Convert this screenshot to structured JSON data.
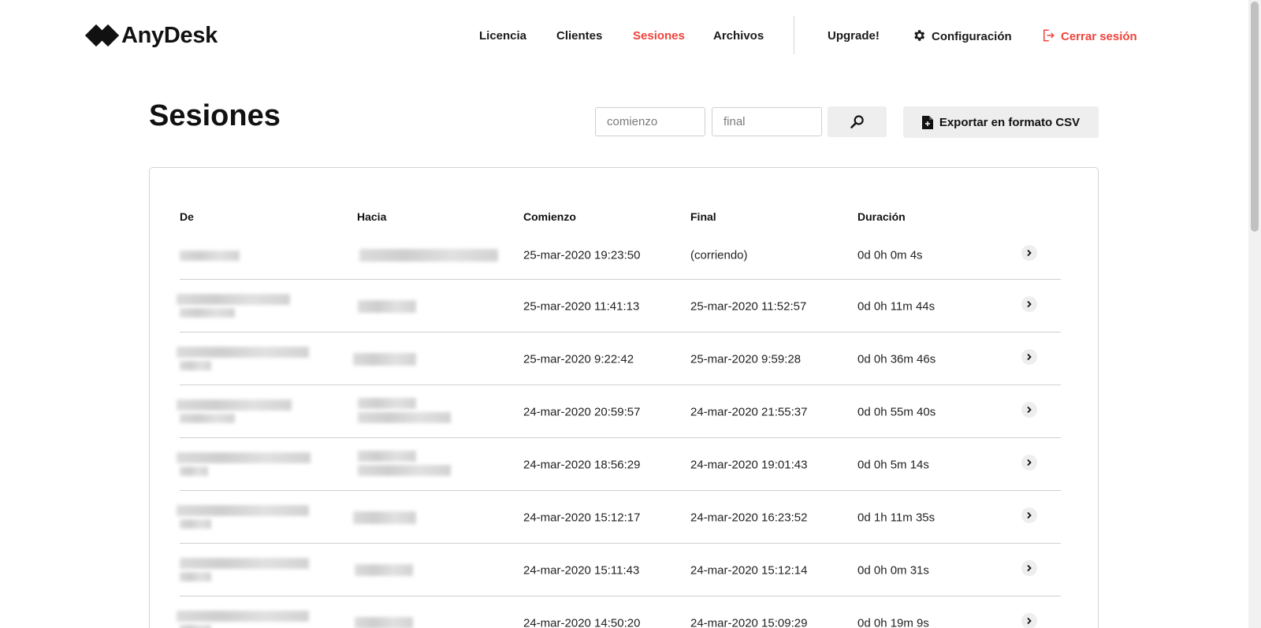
{
  "header": {
    "brand": "AnyDesk",
    "nav": [
      {
        "label": "Licencia",
        "active": false
      },
      {
        "label": "Clientes",
        "active": false
      },
      {
        "label": "Sesiones",
        "active": true
      },
      {
        "label": "Archivos",
        "active": false
      }
    ],
    "upgrade_label": "Upgrade!",
    "settings_label": "Configuración",
    "logout_label": "Cerrar sesión",
    "icons": {
      "settings": "gear-icon",
      "logout": "logout-icon"
    },
    "colors": {
      "accent": "#ef443b",
      "text": "#1a1a1a"
    }
  },
  "page": {
    "title": "Sesiones",
    "start_placeholder": "comienzo",
    "end_placeholder": "final",
    "search_icon": "search-icon",
    "export_label": "Exportar en formato CSV",
    "export_icon": "csv-file-icon"
  },
  "table": {
    "columns": [
      "De",
      "Hacia",
      "Comienzo",
      "Final",
      "Duración"
    ],
    "rows": [
      {
        "start": "25-mar-2020 19:23:50",
        "end": "(corriendo)",
        "duration": "0d 0h 0m 4s"
      },
      {
        "start": "25-mar-2020 11:41:13",
        "end": "25-mar-2020 11:52:57",
        "duration": "0d 0h 11m 44s"
      },
      {
        "start": "25-mar-2020 9:22:42",
        "end": "25-mar-2020 9:59:28",
        "duration": "0d 0h 36m 46s"
      },
      {
        "start": "24-mar-2020 20:59:57",
        "end": "24-mar-2020 21:55:37",
        "duration": "0d 0h 55m 40s"
      },
      {
        "start": "24-mar-2020 18:56:29",
        "end": "24-mar-2020 19:01:43",
        "duration": "0d 0h 5m 14s"
      },
      {
        "start": "24-mar-2020 15:12:17",
        "end": "24-mar-2020 16:23:52",
        "duration": "0d 1h 11m 35s"
      },
      {
        "start": "24-mar-2020 15:11:43",
        "end": "24-mar-2020 15:12:14",
        "duration": "0d 0h 0m 31s"
      },
      {
        "start": "24-mar-2020 14:50:20",
        "end": "24-mar-2020 15:09:29",
        "duration": "0d 0h 19m 9s"
      }
    ],
    "row_action_icon": "chevron-right-icon"
  }
}
